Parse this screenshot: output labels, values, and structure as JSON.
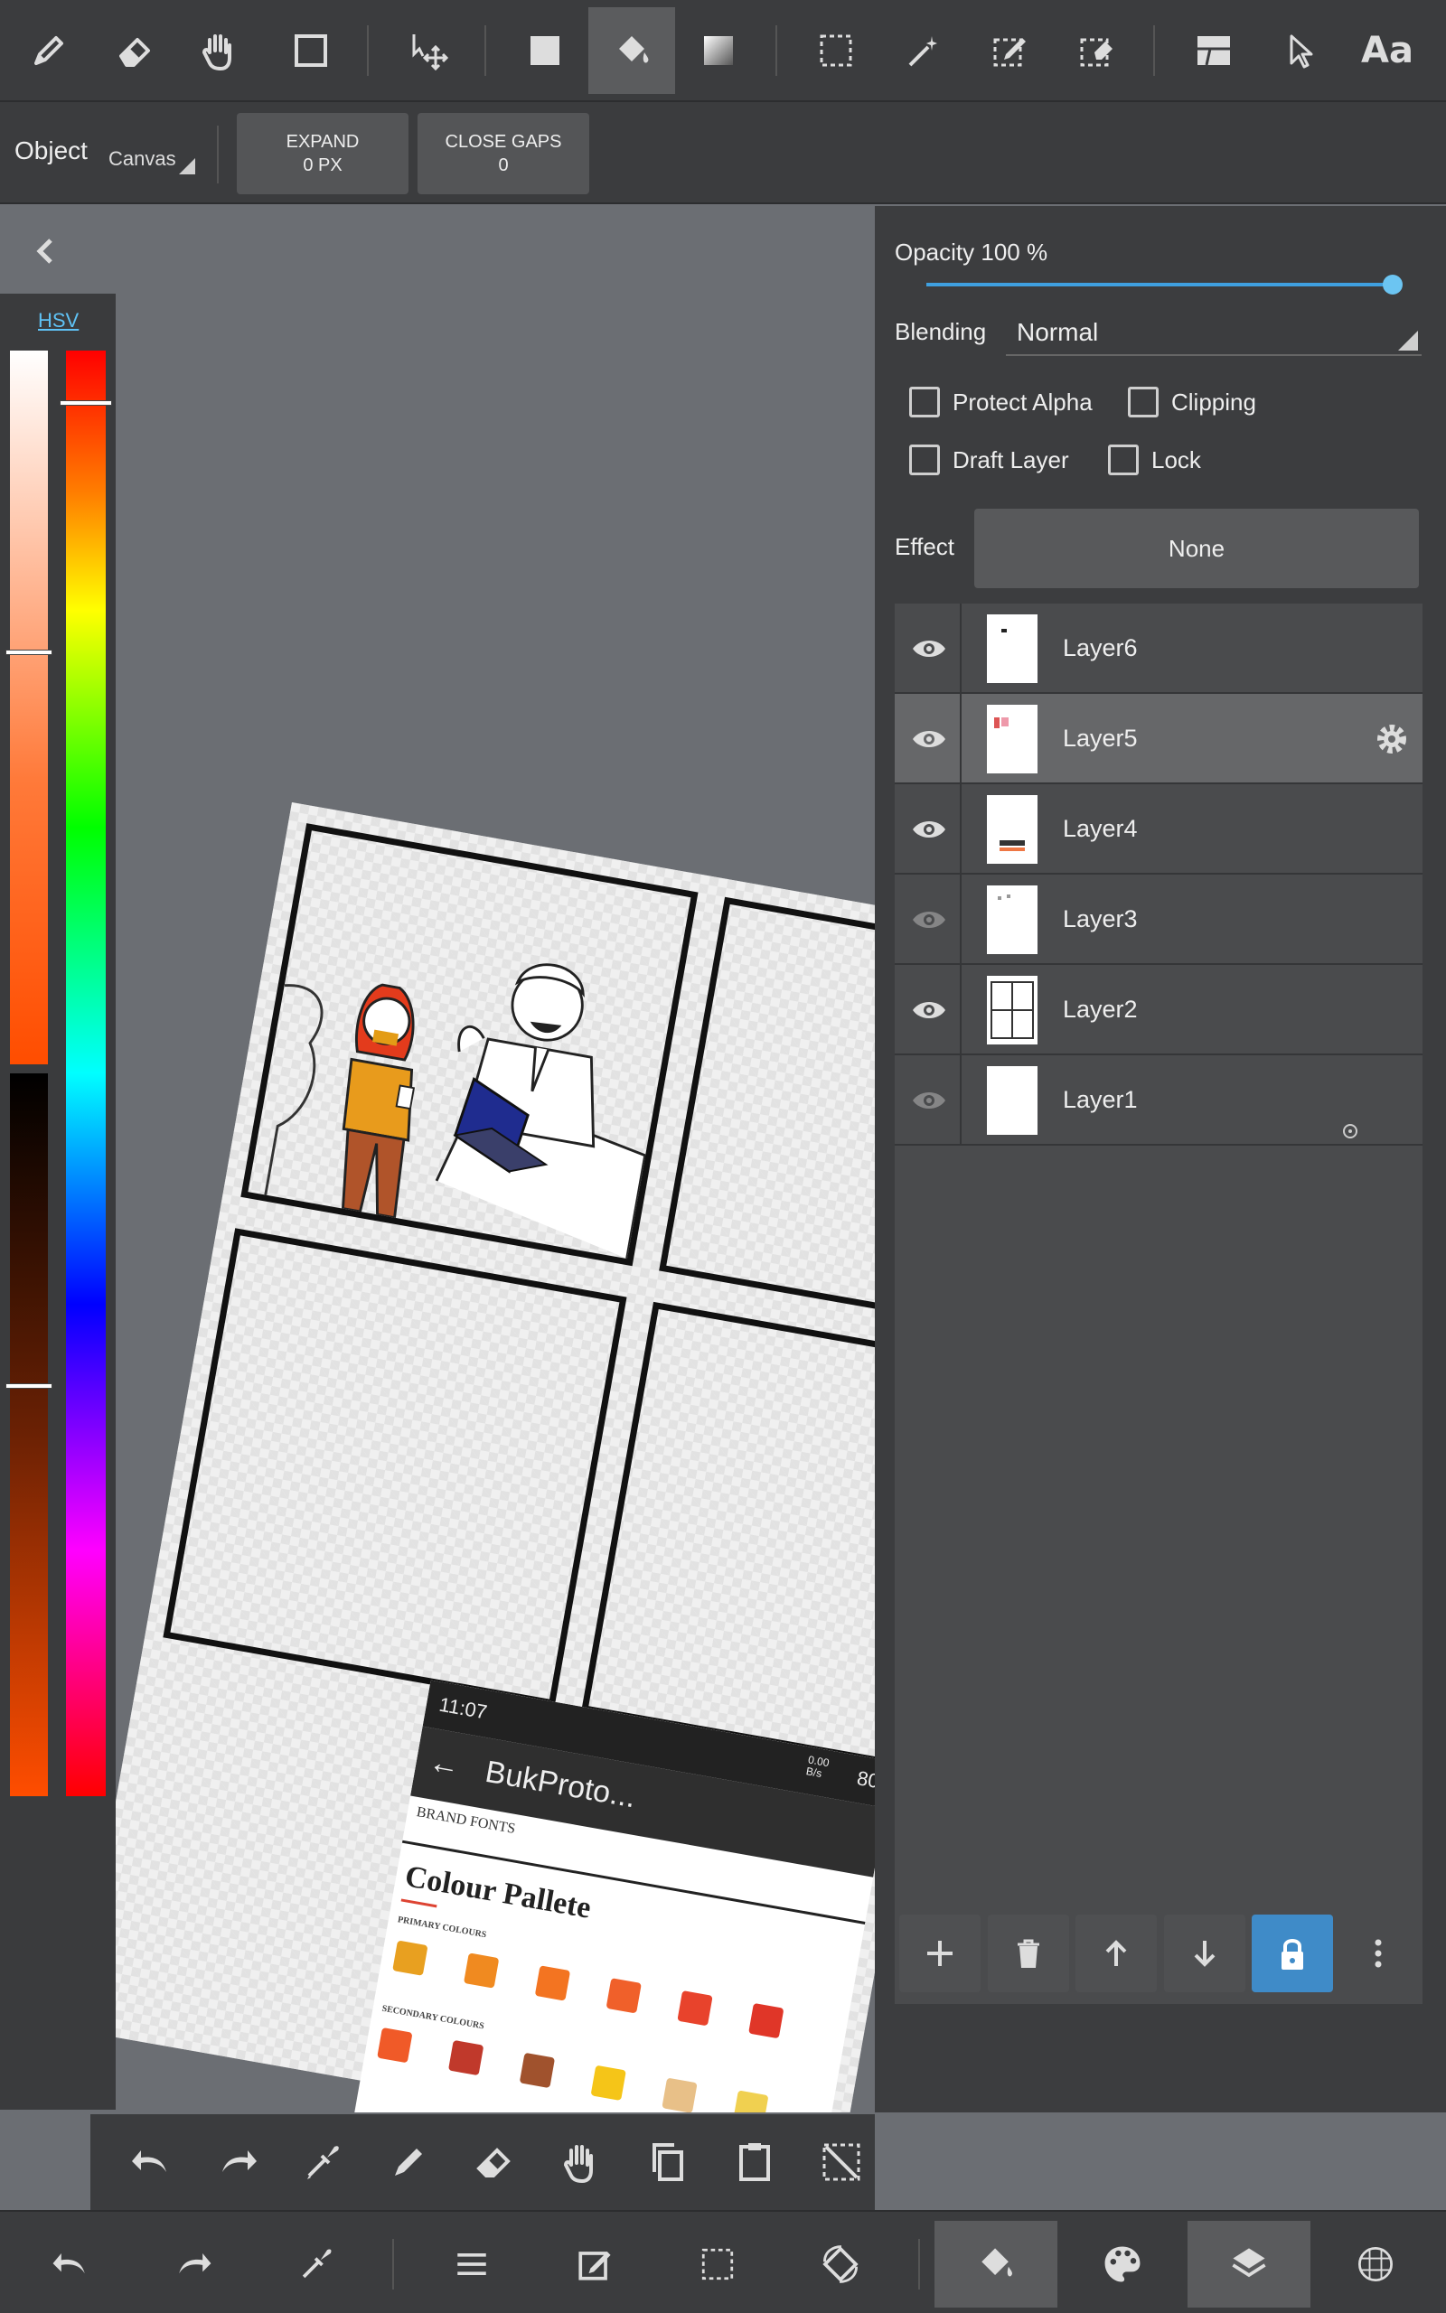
{
  "toolbar": {
    "tools": [
      "pen-icon",
      "eraser-icon",
      "hand-icon",
      "rectangle-icon",
      "move-icon",
      "fill-rect-icon",
      "bucket-icon",
      "gradient-icon",
      "select-rect-icon",
      "magic-wand-icon",
      "select-pen-icon",
      "select-eraser-icon",
      "panel-icon",
      "pointer-icon",
      "text-icon"
    ],
    "text_tool_label": "Aa",
    "active_tool": "bucket-icon"
  },
  "options": {
    "object_label": "Object",
    "object_value": "Canvas",
    "expand_label": "EXPAND",
    "expand_value": "0 PX",
    "close_gaps_label": "CLOSE GAPS",
    "close_gaps_value": "0"
  },
  "color_panel": {
    "mode_label": "HSV",
    "current_color": "#ff4d00",
    "hue_marker_fraction": 0.035,
    "sv_marker_top_fraction": 0.42,
    "sv_marker_bottom_fraction": 0.43
  },
  "layer_properties": {
    "opacity_label": "Opacity 100 %",
    "opacity_value": 100,
    "blending_label": "Blending",
    "blending_value": "Normal",
    "protect_alpha_label": "Protect Alpha",
    "clipping_label": "Clipping",
    "draft_layer_label": "Draft Layer",
    "lock_label": "Lock",
    "effect_label": "Effect",
    "effect_value": "None"
  },
  "layers": [
    {
      "name": "Layer6",
      "visible": true,
      "selected": false
    },
    {
      "name": "Layer5",
      "visible": true,
      "selected": true
    },
    {
      "name": "Layer4",
      "visible": true,
      "selected": false
    },
    {
      "name": "Layer3",
      "visible": false,
      "selected": false
    },
    {
      "name": "Layer2",
      "visible": true,
      "selected": false
    },
    {
      "name": "Layer1",
      "visible": false,
      "selected": false
    }
  ],
  "canvas_screenshot": {
    "time": "11:07",
    "net": "0.00\nB/s",
    "battery": "80",
    "app_title": "BukProto...",
    "brand_fonts": "BRAND FONTS",
    "heading": "Colour Pallete",
    "primary_label": "PRIMARY COLOURS",
    "secondary_label": "SECONDARY COLOURS",
    "primary_colors": [
      "#e8a020",
      "#f08a20",
      "#f37421",
      "#f0602a",
      "#e8432c",
      "#e03628"
    ],
    "secondary_colors": [
      "#f05a28",
      "#c0392b",
      "#a0522d",
      "#f5c518",
      "#e8c088",
      "#f0d050"
    ]
  },
  "accent_color": "#3f8bc8"
}
